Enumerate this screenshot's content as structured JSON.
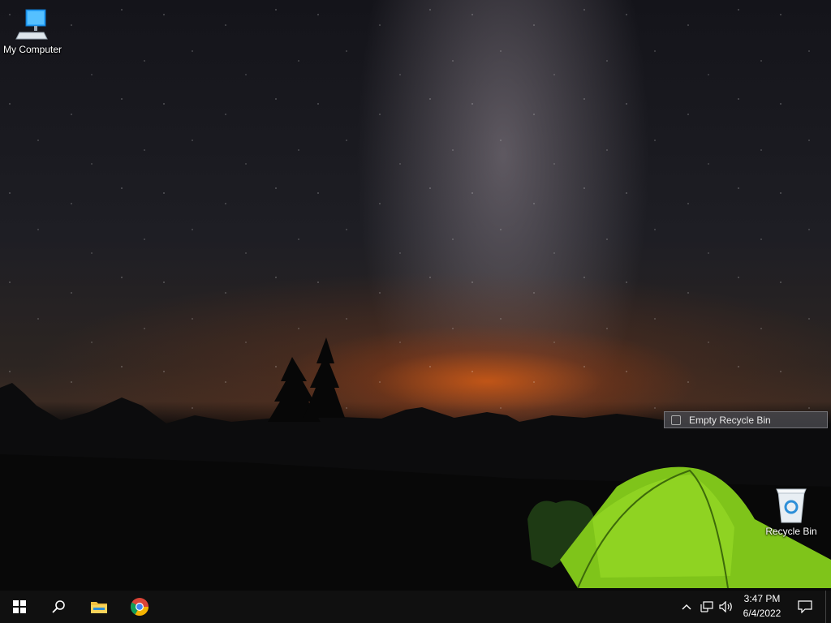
{
  "desktop": {
    "icons": [
      {
        "label": "My Computer",
        "icon": "monitor-icon"
      },
      {
        "label": "Recycle Bin",
        "icon": "recycle-bin-icon"
      }
    ],
    "tooltip": {
      "label": "Empty Recycle Bin",
      "icon": "recycle-bin-small-icon"
    }
  },
  "taskbar": {
    "buttons": [
      {
        "name": "start",
        "icon": "windows-logo-icon"
      },
      {
        "name": "search",
        "icon": "search-icon"
      },
      {
        "name": "file-explorer",
        "icon": "folder-icon"
      },
      {
        "name": "chrome",
        "icon": "chrome-icon"
      }
    ],
    "tray": {
      "icons": [
        "chevron-up-icon",
        "network-icon",
        "volume-icon"
      ],
      "time": "3:47 PM",
      "date": "6/4/2022",
      "notification_icon": "notification-icon"
    },
    "colors": {
      "background": "#101010",
      "accent": "#1e90ff"
    }
  }
}
